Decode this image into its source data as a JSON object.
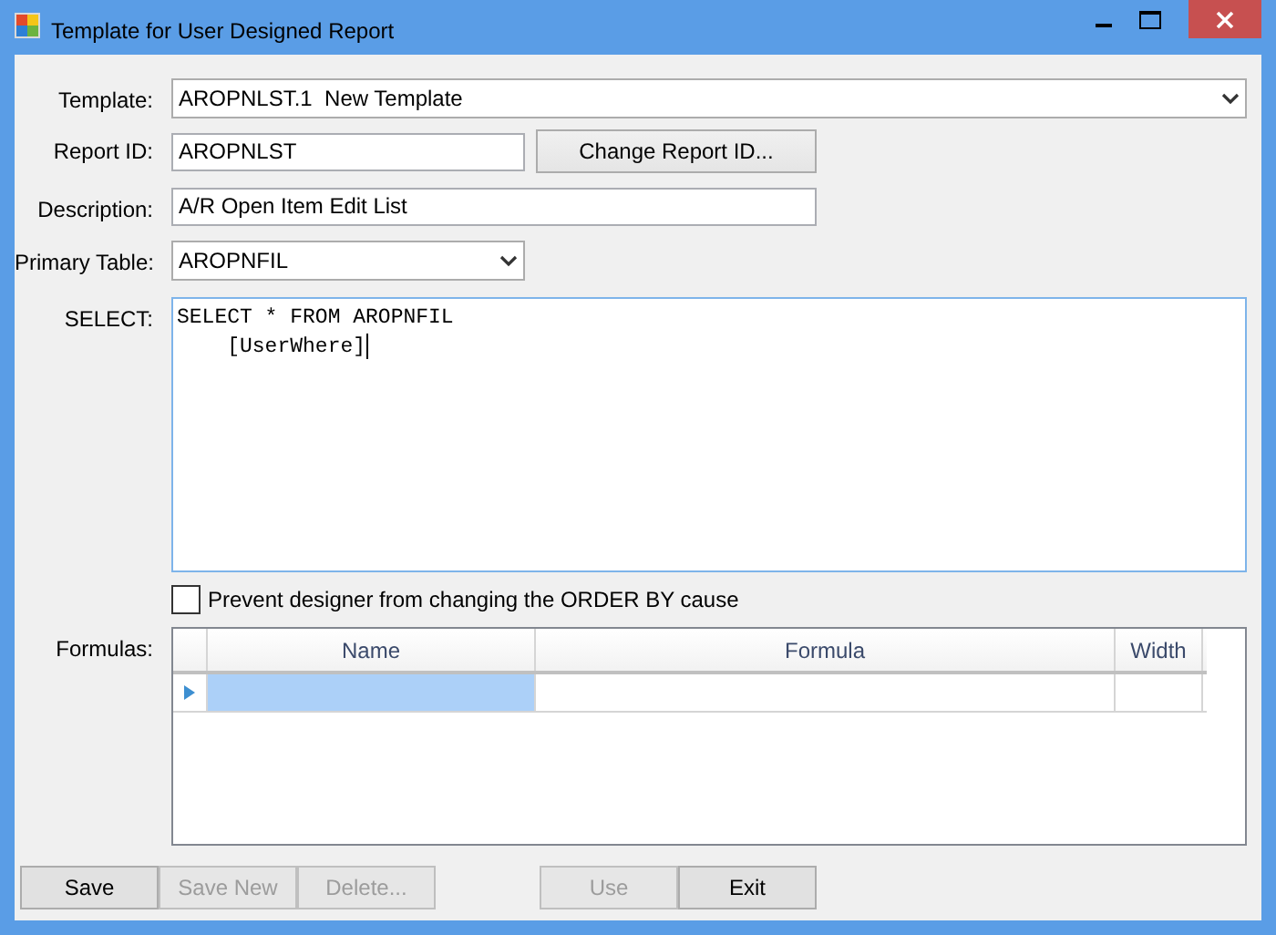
{
  "window": {
    "title": "Template for User Designed Report"
  },
  "template": {
    "label": "Template:",
    "value": "AROPNLST.1  New Template"
  },
  "report_id": {
    "label": "Report ID:",
    "value": "AROPNLST",
    "button": "Change Report ID..."
  },
  "description": {
    "label": "Description:",
    "value": "A/R Open Item Edit List"
  },
  "primary_table": {
    "label": "Primary Table:",
    "value": "AROPNFIL"
  },
  "select": {
    "label": "SELECT:",
    "lines": [
      "SELECT * FROM AROPNFIL",
      "    [UserWhere]"
    ]
  },
  "prevent_order_by": {
    "label": "Prevent designer from changing the ORDER BY cause",
    "checked": false
  },
  "formulas": {
    "label": "Formulas:",
    "columns": [
      "Name",
      "Formula",
      "Width"
    ],
    "rows": [
      {
        "current": true,
        "cells": [
          {
            "selected": true
          },
          {
            "selected": false
          },
          {
            "selected": false
          }
        ]
      }
    ]
  },
  "left_buttons": [
    {
      "label": "Save",
      "disabled": false
    },
    {
      "label": "Save New",
      "disabled": true
    },
    {
      "label": "Delete...",
      "disabled": true
    }
  ],
  "right_buttons": [
    {
      "label": "Use",
      "disabled": true
    },
    {
      "label": "Exit",
      "disabled": false
    }
  ]
}
